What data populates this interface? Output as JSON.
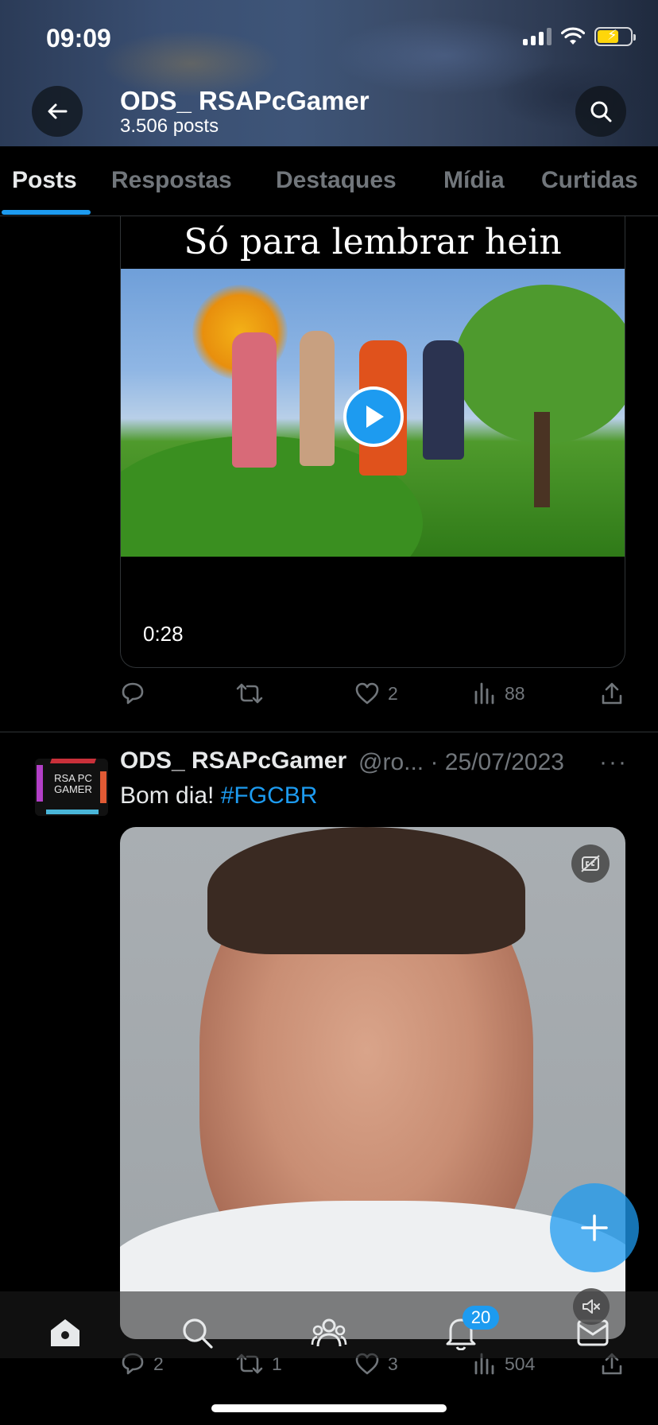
{
  "status_bar": {
    "time": "09:09"
  },
  "header": {
    "profile_name": "ODS_ RSAPcGamer",
    "posts_count": "3.506 posts"
  },
  "tabs": [
    {
      "label": "Posts",
      "active": true
    },
    {
      "label": "Respostas",
      "active": false
    },
    {
      "label": "Destaques",
      "active": false
    },
    {
      "label": "Mídia",
      "active": false
    },
    {
      "label": "Curtidas",
      "active": false
    }
  ],
  "post1": {
    "video_caption": "Só para lembrar hein",
    "video_duration": "0:28",
    "actions": {
      "replies": "",
      "reposts": "",
      "likes": "2",
      "views": "88"
    }
  },
  "post2": {
    "author_name": "ODS_ RSAPcGamer",
    "handle": "@ro...",
    "date": "· 25/07/2023",
    "more": "···",
    "text": "Bom dia!",
    "hashtag": "#FGCBR",
    "avatar_text": "RSA PC GAMER",
    "actions": {
      "replies": "2",
      "reposts": "1",
      "likes": "3",
      "views": "504"
    }
  },
  "bottom_nav": {
    "items": [
      "home-icon",
      "search-icon",
      "communities-icon",
      "notifications-icon",
      "messages-icon"
    ],
    "notifications_badge": "20"
  },
  "colors": {
    "accent": "#1d9bf0",
    "background": "#000000",
    "secondary_text": "#71767b",
    "divider": "#2f3336"
  }
}
